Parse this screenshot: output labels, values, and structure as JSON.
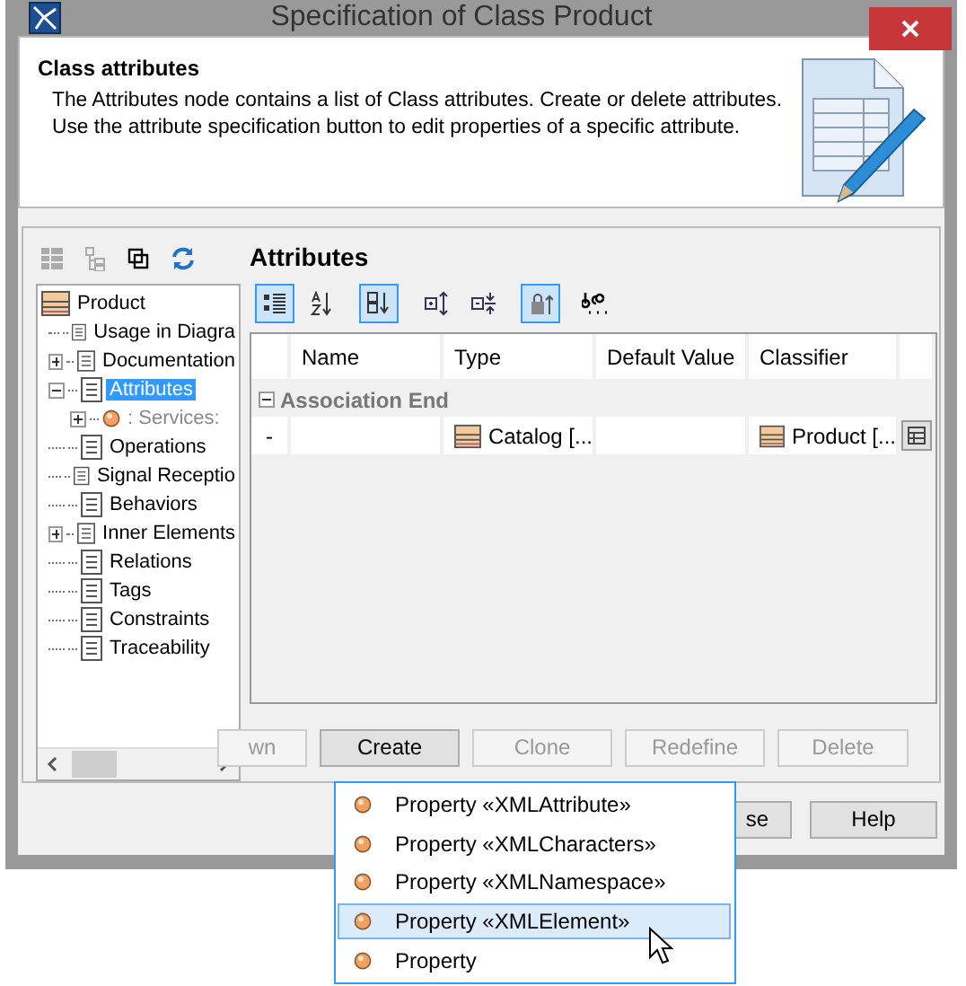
{
  "window": {
    "title": "Specification of Class Product"
  },
  "header": {
    "title": "Class attributes",
    "description": "The Attributes node contains a list of Class attributes. Create or delete attributes. Use the attribute specification button to edit properties of a specific attribute."
  },
  "tree": {
    "items": [
      {
        "label": "Product",
        "kind": "class",
        "selected": false,
        "children": [
          {
            "label": "Usage in Diagra",
            "kind": "doc",
            "selected": false
          },
          {
            "label": "Documentation",
            "kind": "doc",
            "selected": false,
            "expanded": false
          },
          {
            "label": "Attributes",
            "kind": "doc",
            "selected": true,
            "expanded": true,
            "children": [
              {
                "label": ": Services:",
                "kind": "property",
                "selected": false,
                "expanded": false,
                "greyed": true
              }
            ]
          },
          {
            "label": "Operations",
            "kind": "doc",
            "selected": false
          },
          {
            "label": "Signal Receptio",
            "kind": "doc",
            "selected": false
          },
          {
            "label": "Behaviors",
            "kind": "doc",
            "selected": false
          },
          {
            "label": "Inner Elements",
            "kind": "doc",
            "selected": false,
            "expanded": false
          },
          {
            "label": "Relations",
            "kind": "doc",
            "selected": false
          },
          {
            "label": "Tags",
            "kind": "doc",
            "selected": false
          },
          {
            "label": "Constraints",
            "kind": "doc",
            "selected": false
          },
          {
            "label": "Traceability",
            "kind": "doc",
            "selected": false
          }
        ]
      }
    ]
  },
  "section": {
    "title": "Attributes"
  },
  "toolbar": [
    {
      "kind": "grid",
      "pressed": true
    },
    {
      "kind": "sort-az",
      "pressed": false
    },
    {
      "kind": "sort-group",
      "pressed": true
    },
    {
      "kind": "expand",
      "pressed": false
    },
    {
      "kind": "collapse",
      "pressed": false
    },
    {
      "kind": "lock",
      "pressed": true
    },
    {
      "kind": "abc",
      "pressed": false
    }
  ],
  "table": {
    "columns": [
      "",
      "Name",
      "Type",
      "Default Value",
      "Classifier",
      ""
    ],
    "groups": [
      {
        "label": "Association End",
        "expanded": true,
        "rows": [
          {
            "cells": [
              "-",
              "",
              "Catalog [...",
              "",
              "Product [..."
            ]
          }
        ]
      }
    ]
  },
  "buttons": [
    {
      "label": "wn",
      "disabled": true
    },
    {
      "label": "Create",
      "disabled": false
    },
    {
      "label": "Clone",
      "disabled": true
    },
    {
      "label": "Redefine",
      "disabled": true
    },
    {
      "label": "Delete",
      "disabled": true
    }
  ],
  "dialog_buttons": [
    {
      "label": "se"
    },
    {
      "label": "Help"
    }
  ],
  "menu": {
    "items": [
      {
        "label": "Property «XMLAttribute»",
        "selected": false
      },
      {
        "label": "Property «XMLCharacters»",
        "selected": false
      },
      {
        "label": "Property «XMLNamespace»",
        "selected": false
      },
      {
        "label": "Property «XMLElement»",
        "selected": true
      },
      {
        "label": "Property",
        "selected": false
      }
    ]
  }
}
